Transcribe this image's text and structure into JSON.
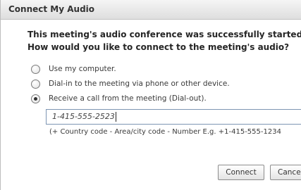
{
  "window": {
    "title": "Connect My Audio"
  },
  "question": {
    "line1": "This meeting's audio conference was successfully started.",
    "line2": "How would you like to connect to the meeting's audio?"
  },
  "options": [
    {
      "label": "Use my computer.",
      "selected": false
    },
    {
      "label": "Dial-in to the meeting via phone or other device.",
      "selected": false
    },
    {
      "label": "Receive a call from the meeting (Dial-out).",
      "selected": true
    }
  ],
  "phone_input": {
    "value": "1-415-555-2523"
  },
  "hint": "(+ Country code - Area/city code - Number E.g. +1-415-555-1234",
  "buttons": {
    "connect": "Connect",
    "cancel": "Cancel"
  }
}
